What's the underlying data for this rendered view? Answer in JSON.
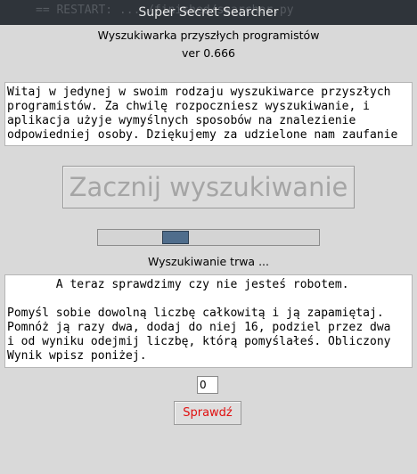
{
  "window": {
    "title": "Super Secret Searcher",
    "background_text": "== RESTART: ... /finished/searcher.py"
  },
  "header": {
    "app_name": "Wyszukiwarka przyszłych programistów",
    "version": "ver 0.666"
  },
  "intro_text": "Witaj w jedynej w swoim rodzaju wyszukiwarce przyszłych\nprogramistów. Za chwilę rozpoczniesz wyszukiwanie, i\naplikacja użyje wymyślnych sposobów na znalezienie\nodpowiedniej osoby. Dziękujemy za udzielone nam zaufanie",
  "search_button_label": "Zacznij wyszukiwanie",
  "progress": {
    "fraction": 0.33,
    "color": "#4f6d8c"
  },
  "status_text": "Wyszukiwanie trwa ...",
  "captcha_text": "       A teraz sprawdzimy czy nie jesteś robotem.\n\nPomyśl sobie dowolną liczbę całkowitą i ją zapamiętaj.\nPomnóż ją razy dwa, dodaj do niej 16, podziel przez dwa\ni od wyniku odejmij liczbę, którą pomyślałeś. Obliczony\nWynik wpisz poniżej.",
  "answer_value": "0",
  "check_button_label": "Sprawdź",
  "colors": {
    "check_button_text": "#e01010",
    "disabled_text": "#a5a5a5"
  }
}
